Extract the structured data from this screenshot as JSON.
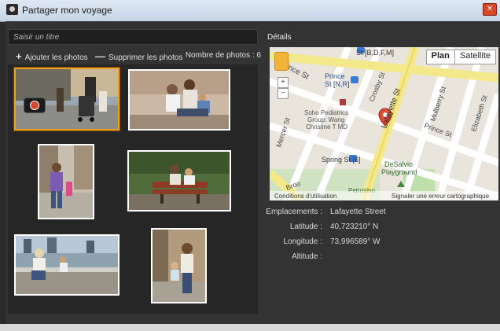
{
  "window": {
    "title": "Partager mon voyage"
  },
  "title_field": {
    "placeholder": "Saisir un titre"
  },
  "toolbar": {
    "add_label": "Ajouter les photos",
    "remove_label": "Supprimer les photos",
    "count_label": "Nombre de photos :",
    "count_value": "6"
  },
  "photos": [
    {
      "name": "photo-street-family",
      "selected": true
    },
    {
      "name": "photo-family-on-stairs",
      "selected": false
    },
    {
      "name": "photo-man-with-child",
      "selected": false
    },
    {
      "name": "photo-family-on-bench",
      "selected": false
    },
    {
      "name": "photo-child-on-railing",
      "selected": false
    },
    {
      "name": "photo-woman-with-child",
      "selected": false
    }
  ],
  "details": {
    "heading": "Détails"
  },
  "map": {
    "toggle": {
      "plan": "Plan",
      "satellite": "Satellite"
    },
    "labels": {
      "prince_st_top": "Prince St",
      "st_bdfm": "St [B,D,F,M]",
      "prince_st_nr": "Prince\nSt [N,R]",
      "crosby": "Crosby St",
      "lafayette": "Lafayette St",
      "mulberry": "Mulberry St",
      "elizabeth": "Elizabeth St",
      "soho": "Soho Pediatrics\nGroup: Wang\nChristine T MD",
      "mercer": "Mercer St",
      "spring_st": "Spring St [6]",
      "prince_st_right": "Prince St",
      "desalvio": "DeSalvio\nPlayground",
      "petrosino": "Petrosino",
      "broome": "Broo",
      "footer_left": "Conditions d'utilisation",
      "footer_right": "Signaler une erreur cartographique"
    }
  },
  "info": {
    "emplacement_label": "Emplacements :",
    "emplacement_value": "Lafayette Street",
    "latitude_label": "Latitude :",
    "latitude_value": "40,723210° N",
    "longitude_label": "Longitude :",
    "longitude_value": "73,996589° W",
    "altitude_label": "Altitude :",
    "altitude_value": ""
  }
}
